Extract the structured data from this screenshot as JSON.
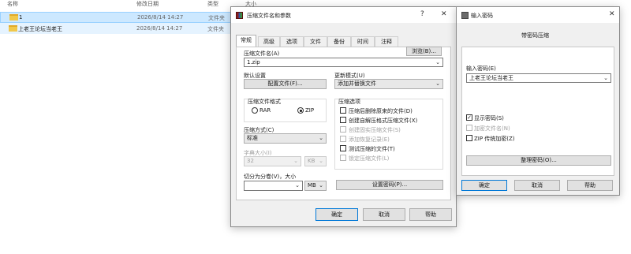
{
  "explorer": {
    "headers": {
      "name": "名称",
      "modified": "修改日期",
      "type": "类型",
      "size": "大小"
    },
    "rows": [
      {
        "name": "1",
        "date": "2026/8/14 14:27",
        "type": "文件夹"
      },
      {
        "name": "上老王论坛当老王",
        "date": "2026/8/14 14:27",
        "type": "文件夹"
      }
    ]
  },
  "winrar": {
    "title": "压缩文件名和参数",
    "help_icon": "?",
    "close_icon": "✕",
    "tabs": [
      "常规",
      "高级",
      "选项",
      "文件",
      "备份",
      "时间",
      "注释"
    ],
    "archive_name_label": "压缩文件名(A)",
    "browse_button": "浏览(B)...",
    "archive_name_value": "1.zip",
    "default_settings_label": "默认设置",
    "profiles_button": "配置文件(F)...",
    "update_mode_label": "更新模式(U)",
    "update_mode_value": "添加并替换文件",
    "format_group_label": "压缩文件格式",
    "format_rar": "RAR",
    "format_zip": "ZIP",
    "selected_format": "ZIP",
    "options_group_label": "压缩选项",
    "options": [
      {
        "label": "压缩后删除原来的文件(D)",
        "checked": false,
        "disabled": false
      },
      {
        "label": "创建自解压格式压缩文件(X)",
        "checked": false,
        "disabled": false
      },
      {
        "label": "创建固实压缩文件(S)",
        "checked": false,
        "disabled": true
      },
      {
        "label": "添加恢复记录(E)",
        "checked": false,
        "disabled": true
      },
      {
        "label": "测试压缩的文件(T)",
        "checked": false,
        "disabled": false
      },
      {
        "label": "锁定压缩文件(L)",
        "checked": false,
        "disabled": true
      }
    ],
    "method_label": "压缩方式(C)",
    "method_value": "标准",
    "dict_label": "字典大小(I)",
    "dict_value": "32",
    "dict_unit": "KB",
    "split_label": "切分为分卷(V)，大小",
    "split_value": "",
    "split_unit": "MB",
    "set_password_button": "设置密码(P)...",
    "ok": "确定",
    "cancel": "取消",
    "help": "帮助"
  },
  "password": {
    "title": "输入密码",
    "close_icon": "✕",
    "header": "带密码压缩",
    "enter_label": "输入密码(E)",
    "enter_value": "上老王论坛当老王",
    "show_password": "显示密码(S)",
    "show_password_checked": true,
    "encrypt_names": "加密文件名(N)",
    "zip_legacy": "ZIP 传统加密(Z)",
    "organize_button": "整理密码(O)...",
    "ok": "确定",
    "cancel": "取消",
    "help": "帮助"
  }
}
